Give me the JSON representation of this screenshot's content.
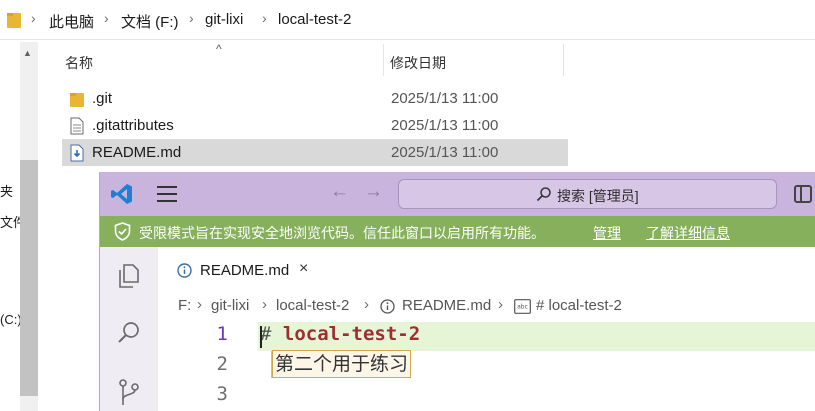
{
  "explorer": {
    "breadcrumb": [
      "此电脑",
      "文档 (F:)",
      "git-lixi",
      "local-test-2"
    ],
    "columns": {
      "name": "名称",
      "modified": "修改日期"
    },
    "files": [
      {
        "name": ".git",
        "modified": "2025/1/13 11:00",
        "icon": "folder-icon"
      },
      {
        "name": ".gitattributes",
        "modified": "2025/1/13 11:00",
        "icon": "document-icon"
      },
      {
        "name": "README.md",
        "modified": "2025/1/13 11:00",
        "icon": "markdown-file-icon",
        "selected": true
      }
    ],
    "left_rail_labels": [
      "夹",
      "文件",
      "(C:)"
    ]
  },
  "vscode": {
    "search_placeholder": "搜索 [管理员]",
    "restricted": {
      "message": "受限模式旨在实现安全地浏览代码。信任此窗口以启用所有功能。",
      "manage_link": "管理",
      "learn_more_link": "了解详细信息"
    },
    "tab": {
      "label": "README.md",
      "close": "×"
    },
    "breadcrumbs": {
      "drive": "F:",
      "folder1": "git-lixi",
      "folder2": "local-test-2",
      "file": "README.md",
      "symbol": "# local-test-2"
    },
    "editor": {
      "line_numbers": [
        "1",
        "2",
        "3"
      ],
      "line1_hash": "#",
      "line1_heading": "local-test-2",
      "line2_text": "第二个用于练习"
    },
    "colors": {
      "titlebar": "#c9b4dd",
      "restricted_bar": "#86b05b",
      "heading": "#9f2f2f",
      "active_line_number": "#6a37c7"
    }
  }
}
